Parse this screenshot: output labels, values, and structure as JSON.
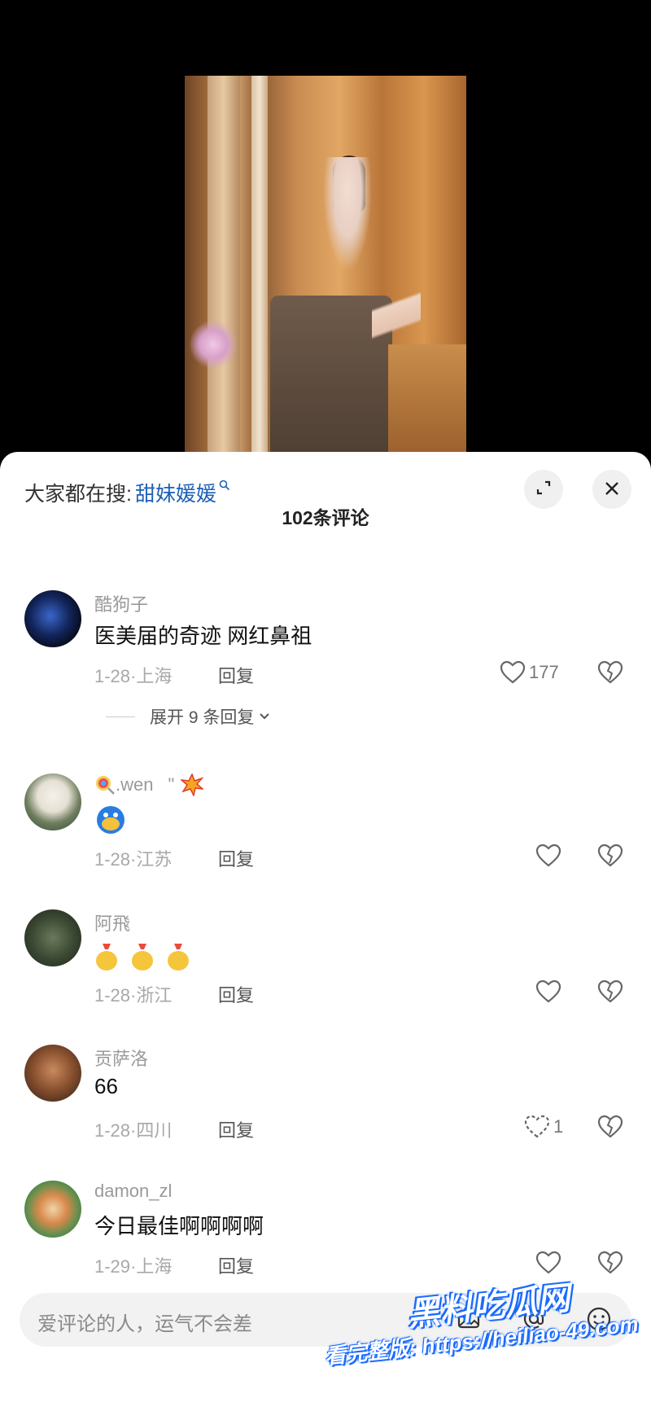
{
  "search": {
    "prefix": "大家都在搜:",
    "term": "甜妹媛媛"
  },
  "comments_count": "102条评论",
  "comments": [
    {
      "username": "酷狗子",
      "text": "医美届的奇迹 网红鼻祖",
      "date": "1-28",
      "location": "上海",
      "reply_label": "回复",
      "likes": "177",
      "expand_label": "展开 9 条回复"
    },
    {
      "username": ".wen",
      "username_suffix": "\"",
      "date": "1-28",
      "location": "江苏",
      "reply_label": "回复",
      "likes": ""
    },
    {
      "username": "阿飛",
      "date": "1-28",
      "location": "浙江",
      "reply_label": "回复",
      "likes": ""
    },
    {
      "username": "贡萨洛",
      "text": "66",
      "date": "1-28",
      "location": "四川",
      "reply_label": "回复",
      "likes": "1"
    },
    {
      "username": "damon_zl",
      "text": "今日最佳啊啊啊啊",
      "date": "1-29",
      "location": "上海",
      "reply_label": "回复",
      "likes": ""
    }
  ],
  "input": {
    "placeholder": "爱评论的人，运气不会差"
  },
  "watermark": {
    "brand": "黑料吃瓜网",
    "url_text": "看完整版: https://heiliao-49.com"
  },
  "icons": [
    "search-icon",
    "expand-icon",
    "close-icon",
    "heart-icon",
    "broken-heart-icon",
    "chevron-down-icon",
    "image-icon",
    "at-icon",
    "emoji-icon"
  ],
  "colors": {
    "search_link": "#1d5fb8",
    "sheet_bg": "#ffffff",
    "background": "#000000"
  }
}
